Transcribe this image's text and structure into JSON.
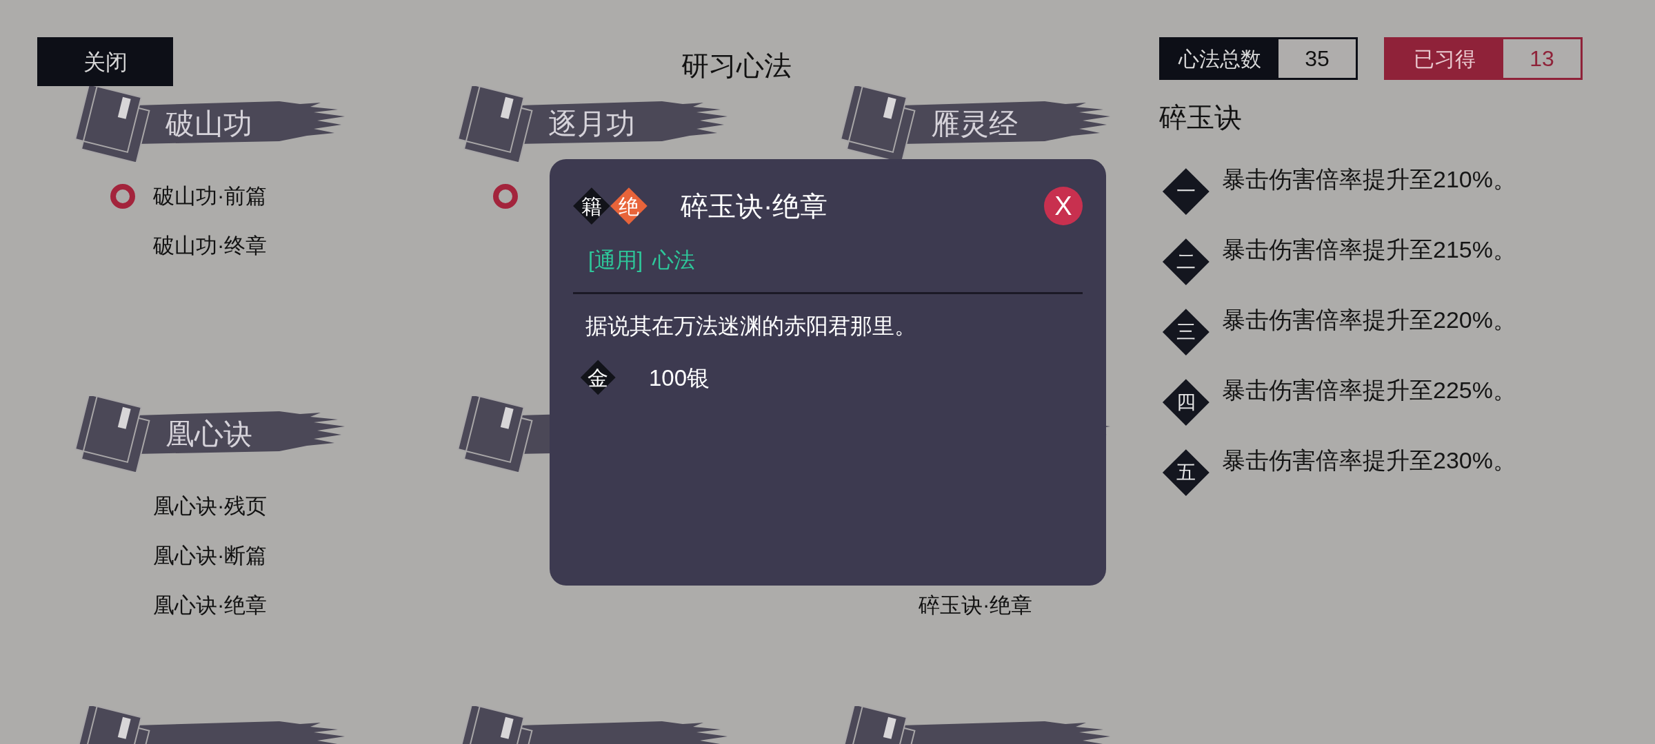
{
  "close_button": "关闭",
  "title": "研习心法",
  "sections": [
    {
      "label": "破山功",
      "items": [
        {
          "label": "破山功·前篇",
          "learned": true
        },
        {
          "label": "破山功·终章",
          "learned": false
        }
      ]
    },
    {
      "label": "逐月功",
      "items": [
        {
          "learned": true
        }
      ]
    },
    {
      "label": "雁灵经"
    },
    {
      "label": "凰心诀",
      "items": [
        {
          "label": "凰心诀·残页",
          "learned": false
        },
        {
          "label": "凰心诀·断篇",
          "learned": false
        },
        {
          "label": "凰心诀·绝章",
          "learned": false
        }
      ]
    },
    {
      "kind": "book"
    },
    {
      "items": [
        {
          "kind": "covered"
        },
        {
          "kind": "covered"
        },
        {
          "kind": "entry",
          "label": "碎玉诀·绝章",
          "learned": false
        }
      ]
    },
    {
      "kind": "book"
    },
    {
      "kind": "book"
    },
    {
      "kind": "book"
    }
  ],
  "stats": [
    {
      "label": "心法总数",
      "value": "35",
      "kind": "total"
    },
    {
      "label": "已习得",
      "value": "13",
      "kind": "learned"
    }
  ],
  "detail": {
    "title": "碎玉诀",
    "effects": [
      {
        "rank": "一",
        "text": "暴击伤害倍率提升至210%。"
      },
      {
        "rank": "二",
        "text": "暴击伤害倍率提升至215%。"
      },
      {
        "rank": "三",
        "text": "暴击伤害倍率提升至220%。"
      },
      {
        "rank": "四",
        "text": "暴击伤害倍率提升至225%。"
      },
      {
        "rank": "五",
        "text": "暴击伤害倍率提升至230%。"
      }
    ]
  },
  "modal": {
    "badges": [
      {
        "text": "籍",
        "color": "#121319"
      },
      {
        "text": "绝",
        "color": "#e8643a"
      }
    ],
    "title": "碎玉诀·绝章",
    "close": "X",
    "tag": "[通用]",
    "category": "心法",
    "description": "据说其在万法迷渊的赤阳君那里。",
    "price_icon": "金",
    "price": "100银"
  }
}
